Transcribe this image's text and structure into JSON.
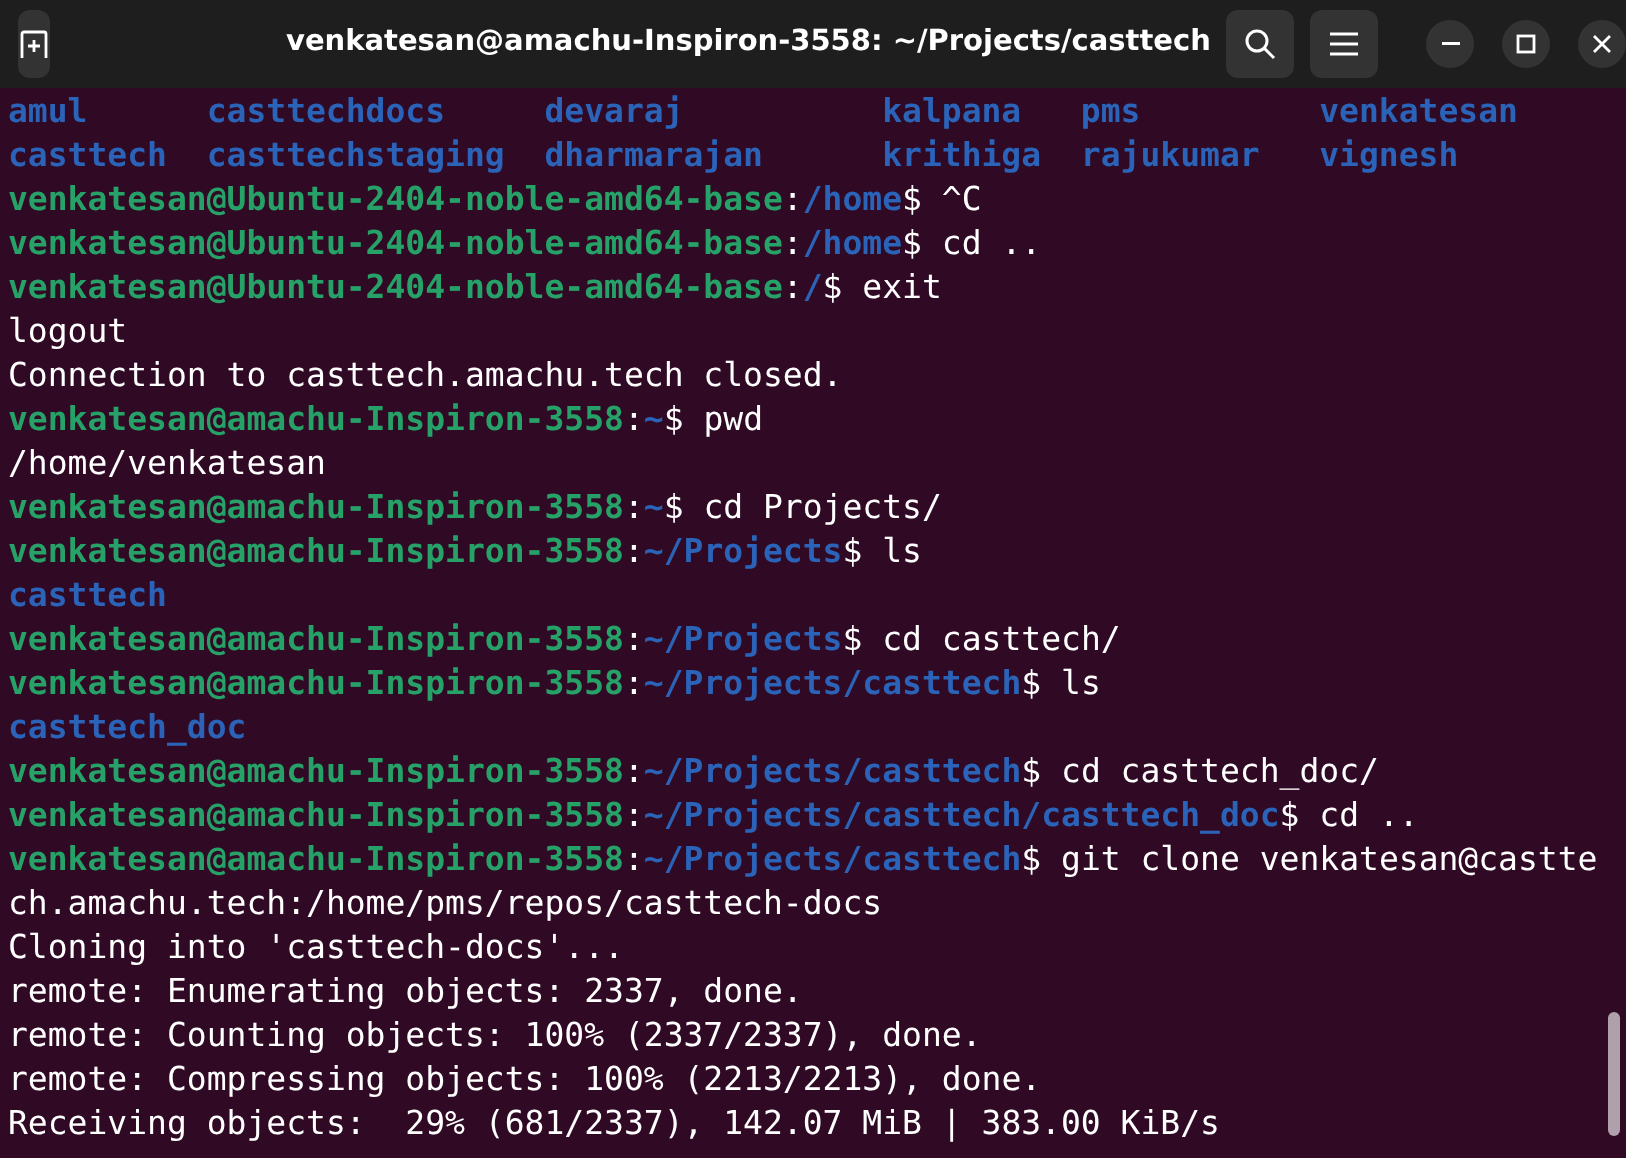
{
  "window": {
    "title": "venkatesan@amachu-Inspiron-3558: ~/Projects/casttech"
  },
  "terminal": {
    "lines": [
      {
        "kind": "listing",
        "entries": [
          "amul",
          "casttechdocs",
          "devaraj",
          "kalpana",
          "pms",
          "venkatesan"
        ]
      },
      {
        "kind": "listing",
        "entries": [
          "casttech",
          "casttechstaging",
          "dharmarajan",
          "krithiga",
          "rajukumar",
          "vignesh"
        ]
      },
      {
        "kind": "prompt",
        "user": "venkatesan@Ubuntu-2404-noble-amd64-base",
        "separator": ":",
        "path": "/home",
        "command": "$ ^C"
      },
      {
        "kind": "prompt",
        "user": "venkatesan@Ubuntu-2404-noble-amd64-base",
        "separator": ":",
        "path": "/home",
        "command": "$ cd .."
      },
      {
        "kind": "prompt",
        "user": "venkatesan@Ubuntu-2404-noble-amd64-base",
        "separator": ":",
        "path": "/",
        "command": "$ exit"
      },
      {
        "kind": "output",
        "text": "logout"
      },
      {
        "kind": "output",
        "text": "Connection to casttech.amachu.tech closed."
      },
      {
        "kind": "prompt",
        "user": "venkatesan@amachu-Inspiron-3558",
        "separator": ":",
        "path": "~",
        "command": "$ pwd"
      },
      {
        "kind": "output",
        "text": "/home/venkatesan"
      },
      {
        "kind": "prompt",
        "user": "venkatesan@amachu-Inspiron-3558",
        "separator": ":",
        "path": "~",
        "command": "$ cd Projects/"
      },
      {
        "kind": "prompt",
        "user": "venkatesan@amachu-Inspiron-3558",
        "separator": ":",
        "path": "~/Projects",
        "command": "$ ls"
      },
      {
        "kind": "listing",
        "entries": [
          "casttech"
        ]
      },
      {
        "kind": "prompt",
        "user": "venkatesan@amachu-Inspiron-3558",
        "separator": ":",
        "path": "~/Projects",
        "command": "$ cd casttech/"
      },
      {
        "kind": "prompt",
        "user": "venkatesan@amachu-Inspiron-3558",
        "separator": ":",
        "path": "~/Projects/casttech",
        "command": "$ ls"
      },
      {
        "kind": "listing",
        "entries": [
          "casttech_doc"
        ]
      },
      {
        "kind": "prompt",
        "user": "venkatesan@amachu-Inspiron-3558",
        "separator": ":",
        "path": "~/Projects/casttech",
        "command": "$ cd casttech_doc/"
      },
      {
        "kind": "prompt",
        "user": "venkatesan@amachu-Inspiron-3558",
        "separator": ":",
        "path": "~/Projects/casttech/casttech_doc",
        "command": "$ cd .."
      },
      {
        "kind": "prompt",
        "user": "venkatesan@amachu-Inspiron-3558",
        "separator": ":",
        "path": "~/Projects/casttech",
        "command": "$ git clone venkatesan@castte"
      },
      {
        "kind": "output",
        "text": "ch.amachu.tech:/home/pms/repos/casttech-docs"
      },
      {
        "kind": "output",
        "text": "Cloning into 'casttech-docs'..."
      },
      {
        "kind": "output",
        "text": "remote: Enumerating objects: 2337, done."
      },
      {
        "kind": "output",
        "text": "remote: Counting objects: 100% (2337/2337), done."
      },
      {
        "kind": "output",
        "text": "remote: Compressing objects: 100% (2213/2213), done."
      },
      {
        "kind": "output",
        "text": "Receiving objects:  29% (681/2337), 142.07 MiB | 383.00 KiB/s"
      }
    ]
  }
}
